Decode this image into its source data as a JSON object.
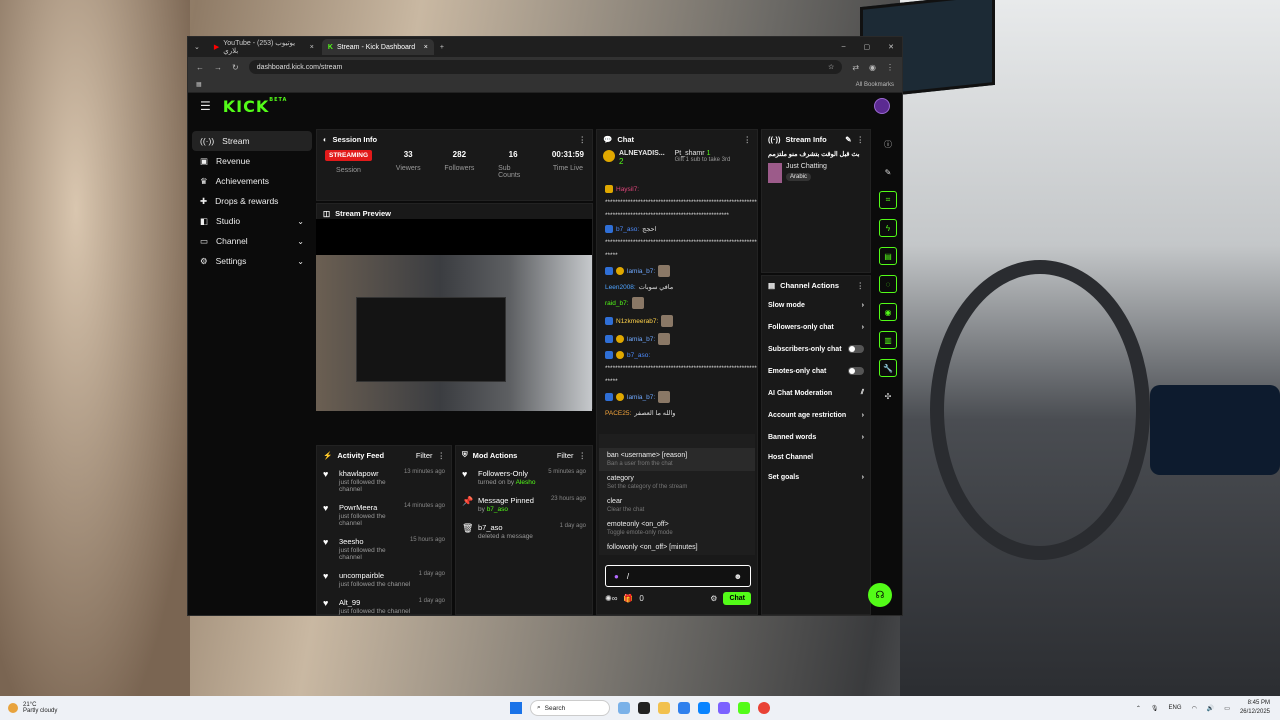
{
  "browser": {
    "tabs": [
      {
        "label": "YouTube - (253) يوتيوب بلاري",
        "active": false
      },
      {
        "label": "Stream - Kick Dashboard",
        "active": true
      }
    ],
    "url": "dashboard.kick.com/stream",
    "all_bookmarks": "All Bookmarks"
  },
  "app": {
    "logo": "KICK",
    "beta": "BETA"
  },
  "sidebar": {
    "items": [
      {
        "label": "Stream",
        "icon": "stream-icon",
        "active": true
      },
      {
        "label": "Revenue",
        "icon": "revenue-icon"
      },
      {
        "label": "Achievements",
        "icon": "trophy-icon"
      },
      {
        "label": "Drops & rewards",
        "icon": "gift-icon"
      },
      {
        "label": "Studio",
        "icon": "studio-icon",
        "chevron": true
      },
      {
        "label": "Channel",
        "icon": "channel-icon",
        "chevron": true
      },
      {
        "label": "Settings",
        "icon": "gear-icon",
        "chevron": true
      }
    ]
  },
  "session": {
    "title": "Session Info",
    "status": "STREAMING",
    "status_label": "Session",
    "stats": [
      {
        "value": "33",
        "label": "Viewers"
      },
      {
        "value": "282",
        "label": "Followers"
      },
      {
        "value": "16",
        "label": "Sub Counts"
      },
      {
        "value": "00:31:59",
        "label": "Time Live"
      }
    ]
  },
  "preview": {
    "title": "Stream Preview"
  },
  "activity": {
    "title": "Activity Feed",
    "filter": "Filter",
    "items": [
      {
        "name": "khawlapowr",
        "sub": "just followed the channel",
        "time": "13 minutes ago"
      },
      {
        "name": "PowrMeera",
        "sub": "just followed the channel",
        "time": "14 minutes ago"
      },
      {
        "name": "3eesho",
        "sub": "just followed the channel",
        "time": "15 hours ago"
      },
      {
        "name": "uncompairble",
        "sub": "just followed the channel",
        "time": "1 day ago"
      },
      {
        "name": "Alt_99",
        "sub": "just followed the channel",
        "time": "1 day ago"
      }
    ]
  },
  "mod": {
    "title": "Mod Actions",
    "filter": "Filter",
    "items": [
      {
        "name": "Followers-Only",
        "sub": "turned on by",
        "by": "Alesho",
        "time": "5 minutes ago",
        "icon": "heart-icon"
      },
      {
        "name": "Message Pinned",
        "sub": "by",
        "by": "b7_aso",
        "time": "23 hours ago",
        "icon": "pin-icon"
      },
      {
        "name": "b7_aso",
        "sub": "deleted a message",
        "by": "",
        "time": "1 day ago",
        "icon": "trash-icon"
      }
    ]
  },
  "chat": {
    "title": "Chat",
    "pinned_user": "ALNEYADIS...",
    "pinned_count": "2",
    "gifter": "Pt_shamr",
    "gifter_count": "1",
    "gift_text": "Gift 1 sub to take 3rd",
    "messages": [
      {
        "user": "Haysil7:",
        "text": "",
        "color": "#e0457b"
      },
      {
        "user": "",
        "text": "*************************************************************",
        "color": "#ddd"
      },
      {
        "user": "",
        "text": "*************************************************",
        "color": "#ddd"
      },
      {
        "user": "b7_aso:",
        "text": "احجج",
        "color": "#4d8cff"
      },
      {
        "user": "",
        "text": "**************************************************************",
        "color": "#ddd"
      },
      {
        "user": "",
        "text": "*****",
        "color": "#ddd"
      },
      {
        "user": "lamia_b7:",
        "text": "",
        "color": "#6fa8ff"
      },
      {
        "user": "Leen2008:",
        "text": "مافي سوبات",
        "color": "#4fa3ff"
      },
      {
        "user": "raid_b7:",
        "text": "",
        "color": "#53fc18"
      },
      {
        "user": "N1zkmeerab7:",
        "text": "",
        "color": "#ffd24a"
      },
      {
        "user": "lamia_b7:",
        "text": "",
        "color": "#6fa8ff"
      },
      {
        "user": "b7_aso:",
        "text": "",
        "color": "#4d8cff"
      },
      {
        "user": "",
        "text": "**************************************************************",
        "color": "#ddd"
      },
      {
        "user": "",
        "text": "*****",
        "color": "#ddd"
      },
      {
        "user": "lamia_b7:",
        "text": "",
        "color": "#6fa8ff"
      },
      {
        "user": "PACE25:",
        "text": "والله ما العصفر",
        "color": "#f2a33a"
      }
    ],
    "commands": [
      {
        "cmd": "ban <username> [reason]",
        "desc": "Ban a user from the chat"
      },
      {
        "cmd": "category",
        "desc": "Set the category of the stream"
      },
      {
        "cmd": "clear",
        "desc": "Clear the chat"
      },
      {
        "cmd": "emoteonly <on_off>",
        "desc": "Toggle emote-only mode"
      },
      {
        "cmd": "followonly <on_off> [minutes]",
        "desc": ""
      }
    ],
    "input_value": "/",
    "points": "0",
    "send": "Chat"
  },
  "stream_info": {
    "title": "Stream Info",
    "stream_title": "بث قبل الوقت بتشرف منو ملتزمم",
    "category": "Just Chatting",
    "tag": "Arabic"
  },
  "channel_actions": {
    "title": "Channel Actions",
    "items": [
      {
        "label": "Slow mode",
        "type": "chevron"
      },
      {
        "label": "Followers-only chat",
        "type": "chevron"
      },
      {
        "label": "Subscribers-only chat",
        "type": "toggle"
      },
      {
        "label": "Emotes-only chat",
        "type": "toggle"
      },
      {
        "label": "AI Chat Moderation",
        "type": "chart"
      },
      {
        "label": "Account age restriction",
        "type": "chevron"
      },
      {
        "label": "Banned words",
        "type": "chevron"
      },
      {
        "label": "Host Channel",
        "type": "none"
      },
      {
        "label": "Set goals",
        "type": "chevron"
      }
    ]
  },
  "taskbar": {
    "temp": "21°C",
    "weather": "Partly cloudy",
    "search": "Search",
    "lang": "ENG",
    "time": "8:45 PM",
    "date": "26/12/2025"
  },
  "colors": {
    "accent": "#53fc18",
    "live": "#e21a1a"
  }
}
